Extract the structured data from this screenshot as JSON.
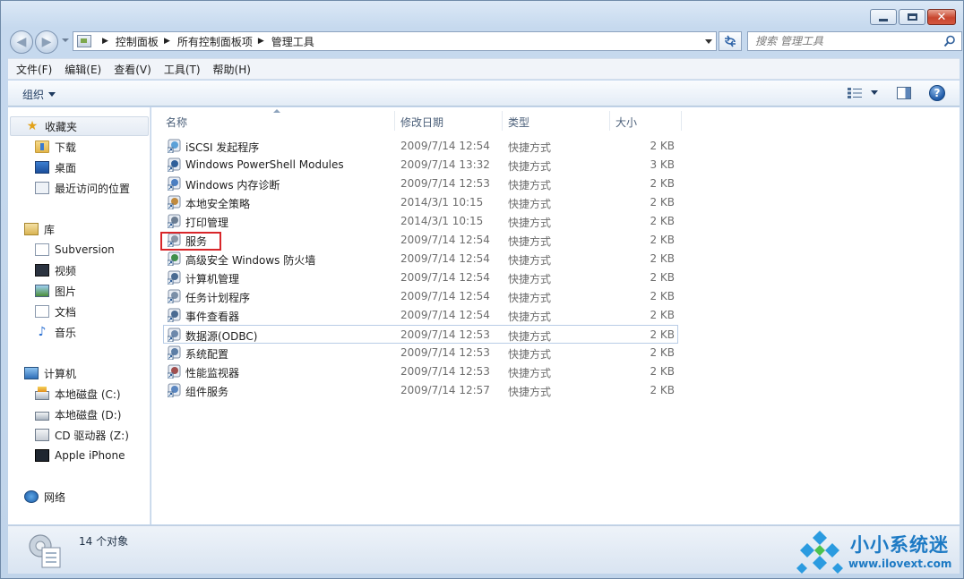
{
  "window": {
    "caption": {
      "minimize": "",
      "maximize": "",
      "close": "✕"
    }
  },
  "address": {
    "breadcrumbs": [
      "控制面板",
      "所有控制面板项",
      "管理工具"
    ],
    "search_placeholder": "搜索 管理工具"
  },
  "menubar": {
    "items": [
      "文件(F)",
      "编辑(E)",
      "查看(V)",
      "工具(T)",
      "帮助(H)"
    ]
  },
  "command_bar": {
    "organize_label": "组织"
  },
  "nav_pane": {
    "favorites": {
      "label": "收藏夹",
      "items": [
        "下载",
        "桌面",
        "最近访问的位置"
      ]
    },
    "libraries": {
      "label": "库",
      "items": [
        "Subversion",
        "视频",
        "图片",
        "文档",
        "音乐"
      ]
    },
    "computer": {
      "label": "计算机",
      "items": [
        "本地磁盘 (C:)",
        "本地磁盘 (D:)",
        "CD 驱动器 (Z:)",
        "Apple iPhone"
      ]
    },
    "network": {
      "label": "网络"
    }
  },
  "columns": {
    "name": "名称",
    "date": "修改日期",
    "type": "类型",
    "size": "大小"
  },
  "files": [
    {
      "name": "iSCSI 发起程序",
      "date": "2009/7/14 12:54",
      "type": "快捷方式",
      "size": "2 KB"
    },
    {
      "name": "Windows PowerShell Modules",
      "date": "2009/7/14 13:32",
      "type": "快捷方式",
      "size": "3 KB"
    },
    {
      "name": "Windows 内存诊断",
      "date": "2009/7/14 12:53",
      "type": "快捷方式",
      "size": "2 KB"
    },
    {
      "name": "本地安全策略",
      "date": "2014/3/1 10:15",
      "type": "快捷方式",
      "size": "2 KB"
    },
    {
      "name": "打印管理",
      "date": "2014/3/1 10:15",
      "type": "快捷方式",
      "size": "2 KB"
    },
    {
      "name": "服务",
      "date": "2009/7/14 12:54",
      "type": "快捷方式",
      "size": "2 KB"
    },
    {
      "name": "高级安全 Windows 防火墙",
      "date": "2009/7/14 12:54",
      "type": "快捷方式",
      "size": "2 KB"
    },
    {
      "name": "计算机管理",
      "date": "2009/7/14 12:54",
      "type": "快捷方式",
      "size": "2 KB"
    },
    {
      "name": "任务计划程序",
      "date": "2009/7/14 12:54",
      "type": "快捷方式",
      "size": "2 KB"
    },
    {
      "name": "事件查看器",
      "date": "2009/7/14 12:54",
      "type": "快捷方式",
      "size": "2 KB"
    },
    {
      "name": "数据源(ODBC)",
      "date": "2009/7/14 12:53",
      "type": "快捷方式",
      "size": "2 KB"
    },
    {
      "name": "系统配置",
      "date": "2009/7/14 12:53",
      "type": "快捷方式",
      "size": "2 KB"
    },
    {
      "name": "性能监视器",
      "date": "2009/7/14 12:53",
      "type": "快捷方式",
      "size": "2 KB"
    },
    {
      "name": "组件服务",
      "date": "2009/7/14 12:57",
      "type": "快捷方式",
      "size": "2 KB"
    }
  ],
  "status": {
    "count_text": "14 个对象"
  },
  "watermark": {
    "title": "小小系统迷",
    "url": "www.ilovext.com"
  },
  "colors": {
    "highlight": "#d8262a",
    "accent": "#1d7ac4"
  }
}
